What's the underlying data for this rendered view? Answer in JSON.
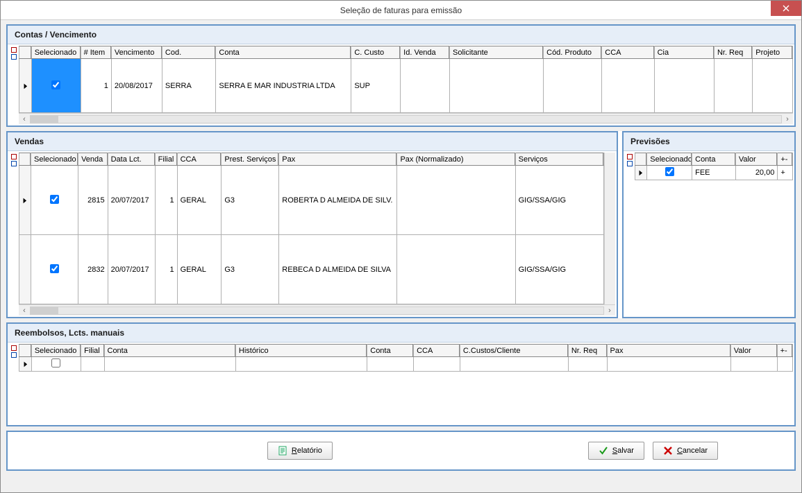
{
  "window": {
    "title": "Seleção de faturas para emissão"
  },
  "panels": {
    "contas": {
      "title": "Contas / Vencimento"
    },
    "vendas": {
      "title": "Vendas"
    },
    "previsoes": {
      "title": "Previsões"
    },
    "reembolsos": {
      "title": "Reembolsos, Lcts. manuais"
    }
  },
  "buttons": {
    "relatorio": "Relatório",
    "salvar": "Salvar",
    "cancelar": "Cancelar"
  },
  "contas": {
    "columns": [
      "Selecionado",
      "# Item",
      "Vencimento",
      "Cod.",
      "Conta",
      "C. Custo",
      "Id. Venda",
      "Solicitante",
      "Cód. Produto",
      "CCA",
      "Cia",
      "Nr. Req",
      "Projeto"
    ],
    "rows": [
      {
        "selecionado": true,
        "item": "1",
        "vencimento": "20/08/2017",
        "cod": "SERRA",
        "conta": "SERRA E MAR INDUSTRIA LTDA",
        "c_custo": "SUP",
        "id_venda": "",
        "solicitante": "",
        "cod_produto": "",
        "cca": "",
        "cia": "",
        "nr_req": "",
        "projeto": ""
      }
    ]
  },
  "vendas": {
    "columns": [
      "Selecionado",
      "Venda",
      "Data Lct.",
      "Filial",
      "CCA",
      "Prest. Serviços",
      "Pax",
      "Pax (Normalizado)",
      "Serviços"
    ],
    "rows": [
      {
        "selecionado": true,
        "venda": "2815",
        "data_lct": "20/07/2017",
        "filial": "1",
        "cca": "GERAL",
        "prest": "G3",
        "pax": "ROBERTA D ALMEIDA DE SILV.",
        "pax_norm": "",
        "servicos": "GIG/SSA/GIG"
      },
      {
        "selecionado": true,
        "venda": "2832",
        "data_lct": "20/07/2017",
        "filial": "1",
        "cca": "GERAL",
        "prest": "G3",
        "pax": "REBECA D ALMEIDA DE SILVA",
        "pax_norm": "",
        "servicos": "GIG/SSA/GIG"
      }
    ]
  },
  "previsoes": {
    "columns": [
      "Selecionado",
      "Conta",
      "Valor",
      "+-"
    ],
    "rows": [
      {
        "selecionado": true,
        "conta": "FEE",
        "valor": "20,00",
        "pm": "+"
      }
    ]
  },
  "reembolsos": {
    "columns": [
      "Selecionado",
      "Filial",
      "Conta",
      "Histórico",
      "Conta",
      "CCA",
      "C.Custos/Cliente",
      "Nr. Req",
      "Pax",
      "Valor",
      "+-"
    ],
    "rows": [
      {
        "selecionado": false,
        "filial": "",
        "conta1": "",
        "historico": "",
        "conta2": "",
        "cca": "",
        "ccustos": "",
        "nr_req": "",
        "pax": "",
        "valor": "",
        "pm": ""
      }
    ]
  }
}
